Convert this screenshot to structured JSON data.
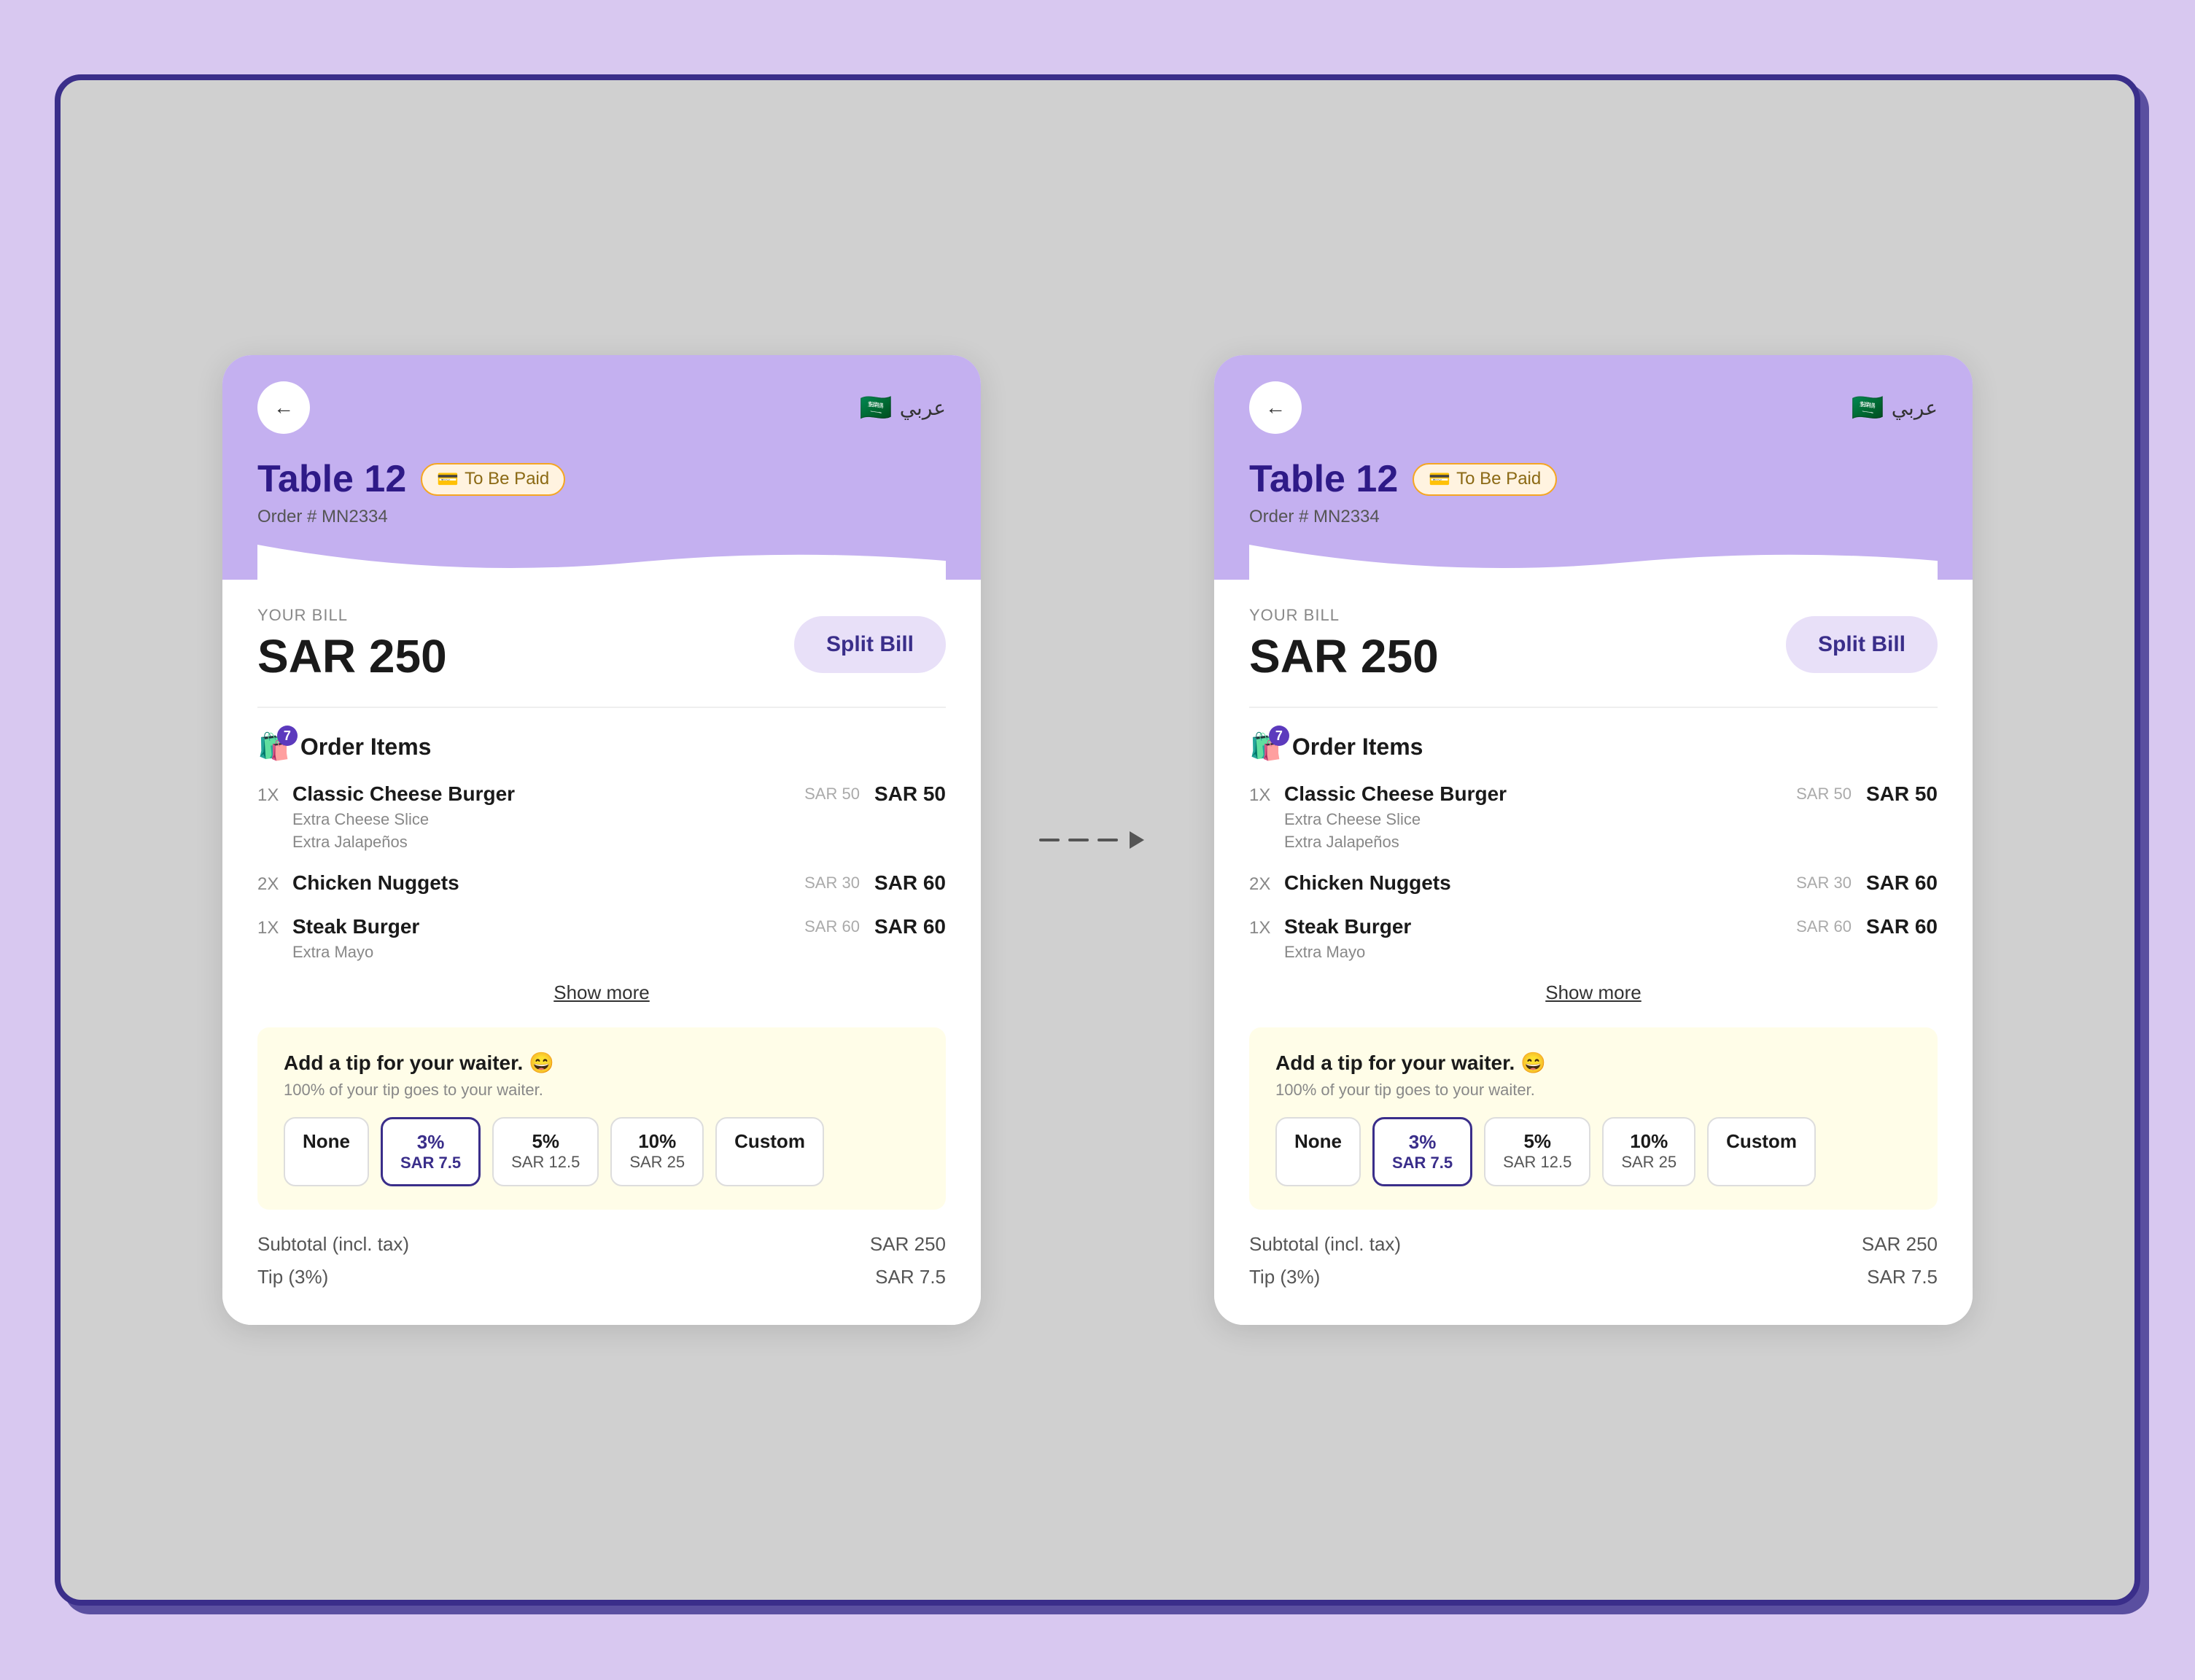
{
  "page": {
    "background": "#d8c8f0"
  },
  "shared": {
    "back_label": "←",
    "lang_label": "عربي",
    "flag": "🇸🇦",
    "table_title": "Table 12",
    "status_badge_icon": "💳",
    "status_badge": "To Be Paid",
    "order_num": "Order # MN2334",
    "bill_label": "YOUR BILL",
    "bill_amount": "SAR 250",
    "split_bill": "Split Bill",
    "order_section_label": "Order Items",
    "order_count": "7",
    "items": [
      {
        "qty": "1X",
        "name": "Classic Cheese Burger",
        "mods": [
          "Extra Cheese Slice",
          "Extra Jalapeños"
        ],
        "unit": "SAR 50",
        "total": "SAR 50"
      },
      {
        "qty": "2X",
        "name": "Chicken Nuggets",
        "mods": [],
        "unit": "SAR 30",
        "total": "SAR 60"
      },
      {
        "qty": "1X",
        "name": "Steak Burger",
        "mods": [
          "Extra Mayo"
        ],
        "unit": "SAR 60",
        "total": "SAR 60"
      }
    ],
    "show_more": "Show more",
    "tip_title": "Add a tip for your waiter. 😄",
    "tip_subtitle": "100% of your tip goes to your waiter.",
    "tip_options": [
      {
        "label": "None",
        "amount": ""
      },
      {
        "label": "3%",
        "amount": "SAR 7.5",
        "selected": true
      },
      {
        "label": "5%",
        "amount": "SAR 12.5"
      },
      {
        "label": "10%",
        "amount": "SAR 25"
      },
      {
        "label": "Custom",
        "amount": ""
      }
    ],
    "summary": [
      {
        "label": "Subtotal (incl. tax)",
        "value": "SAR 250"
      },
      {
        "label": "Tip (3%)",
        "value": "SAR 7.5"
      }
    ]
  },
  "arrow": {
    "dashes": 3
  }
}
